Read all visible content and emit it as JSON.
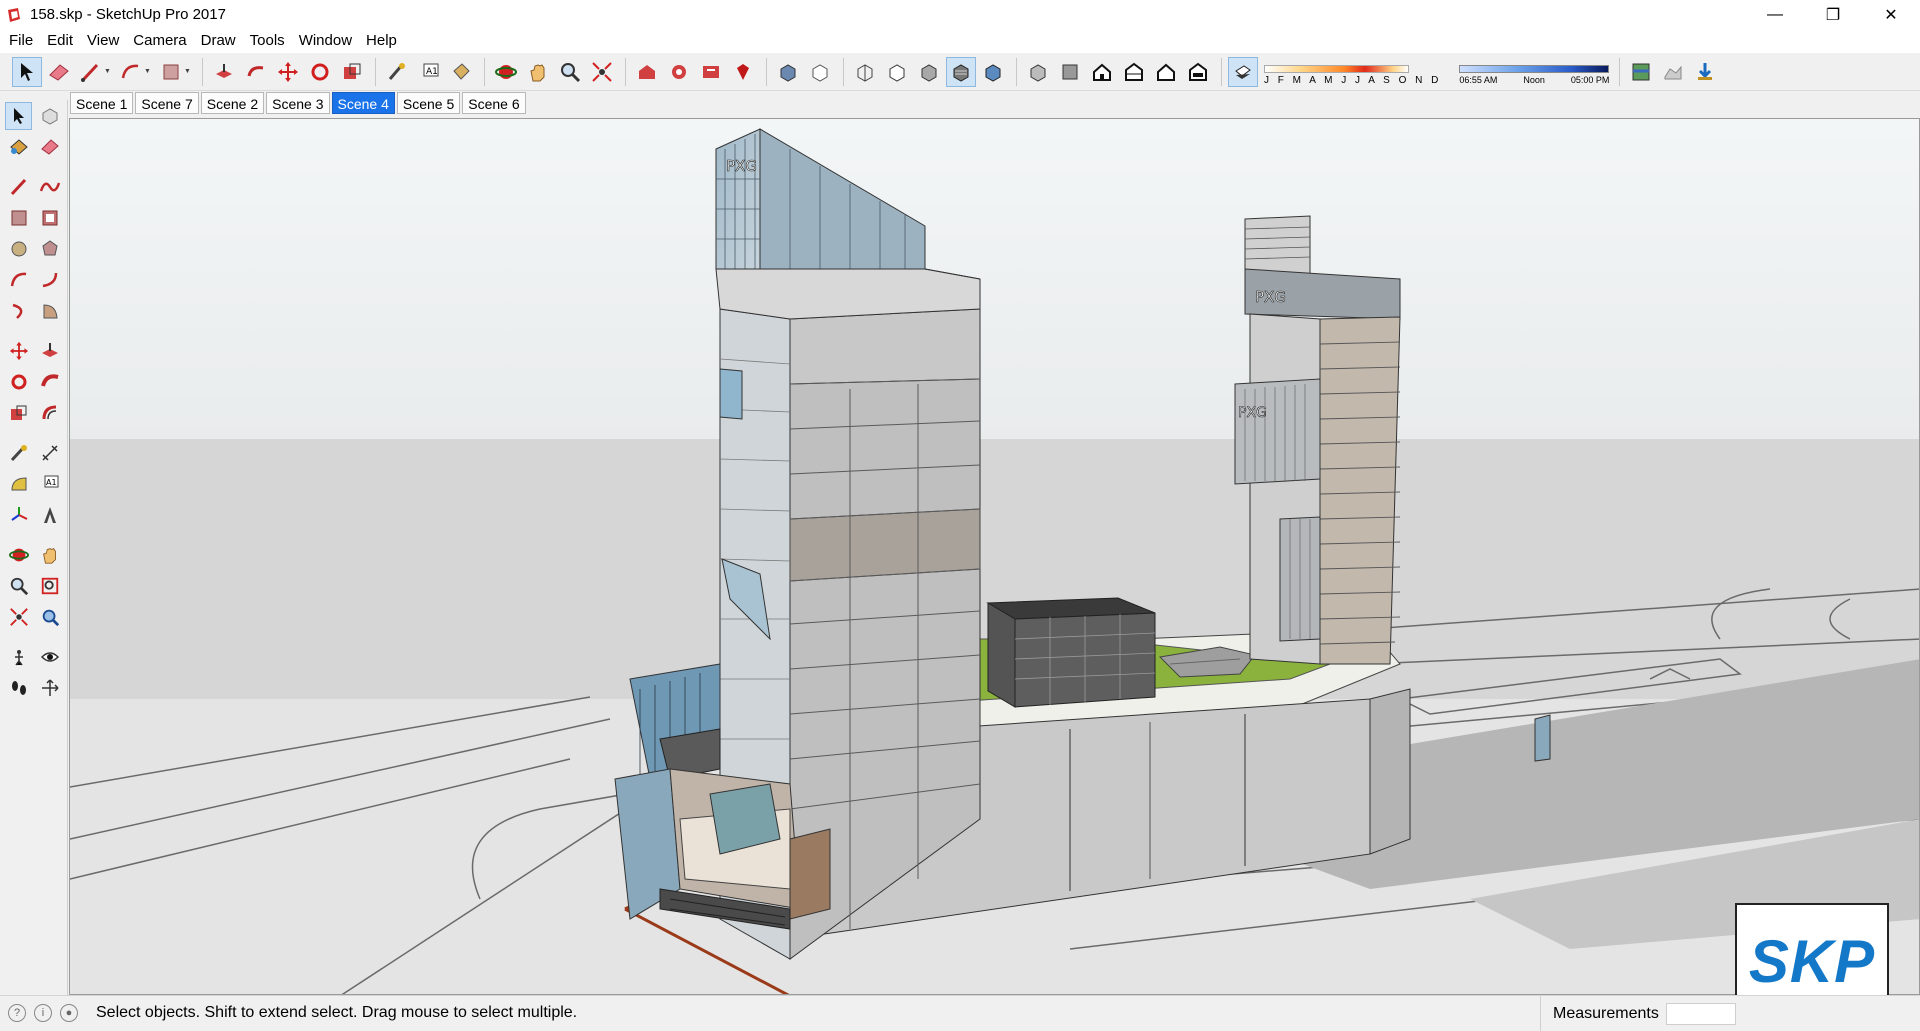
{
  "window": {
    "title": "158.skp - SketchUp Pro 2017",
    "controls": {
      "minimize": "—",
      "restore": "❐",
      "close": "✕"
    }
  },
  "menu": [
    "File",
    "Edit",
    "View",
    "Camera",
    "Draw",
    "Tools",
    "Window",
    "Help"
  ],
  "toolbar": {
    "shadow_months": "J F M A M J J A S O N D",
    "shadow_time_start": "06:55 AM",
    "shadow_time_mid": "Noon",
    "shadow_time_end": "05:00 PM"
  },
  "scenes": {
    "tabs": [
      "Scene 1",
      "Scene 7",
      "Scene 2",
      "Scene 3",
      "Scene 4",
      "Scene 5",
      "Scene 6"
    ],
    "active": "Scene 4"
  },
  "model": {
    "tower_logo": "PXG"
  },
  "watermark": {
    "logo_text": "SKP"
  },
  "status": {
    "message": "Select objects. Shift to extend select. Drag mouse to select multiple.",
    "measurements_label": "Measurements",
    "measurements_value": ""
  },
  "colors": {
    "accent": "#1a73e8",
    "lawn": "#8ab23c",
    "sky_top": "#f3f6f7",
    "ground": "#d6d6d6"
  }
}
